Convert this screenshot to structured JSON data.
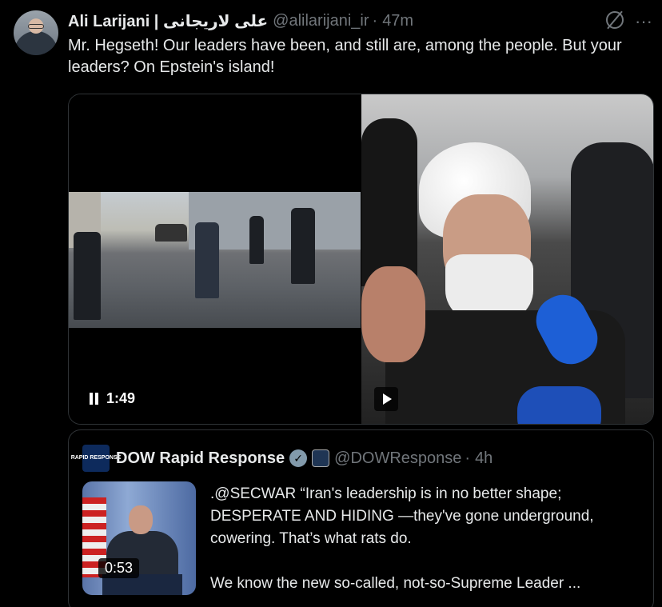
{
  "tweet": {
    "author_name": "Ali Larijani | علی لاریجانی",
    "handle": "@alilarijani_ir",
    "separator": "·",
    "time": "47m",
    "text": "Mr. Hegseth! Our leaders have been, and still are, among the people. But your leaders? On Epstein's island!",
    "more_icon": "···"
  },
  "media": {
    "left_video_duration": "1:49",
    "left_icon": "pause-icon",
    "right_icon": "play-icon"
  },
  "quote": {
    "avatar_text": "RAPID RESPONSE",
    "author_name": "DOW Rapid Response",
    "handle": "@DOWResponse",
    "separator": "·",
    "time": "4h",
    "video_duration": "0:53",
    "text_line1": ".@SECWAR “Iran's leadership is in no better shape; DESPERATE AND HIDING —they've gone underground, cowering. That’s what rats do.",
    "text_line2": "We know the new so-called, not-so-Supreme Leader ..."
  },
  "colors": {
    "background": "#000000",
    "text_primary": "#e7e9ea",
    "text_secondary": "#71767b",
    "border": "#2f3336"
  }
}
